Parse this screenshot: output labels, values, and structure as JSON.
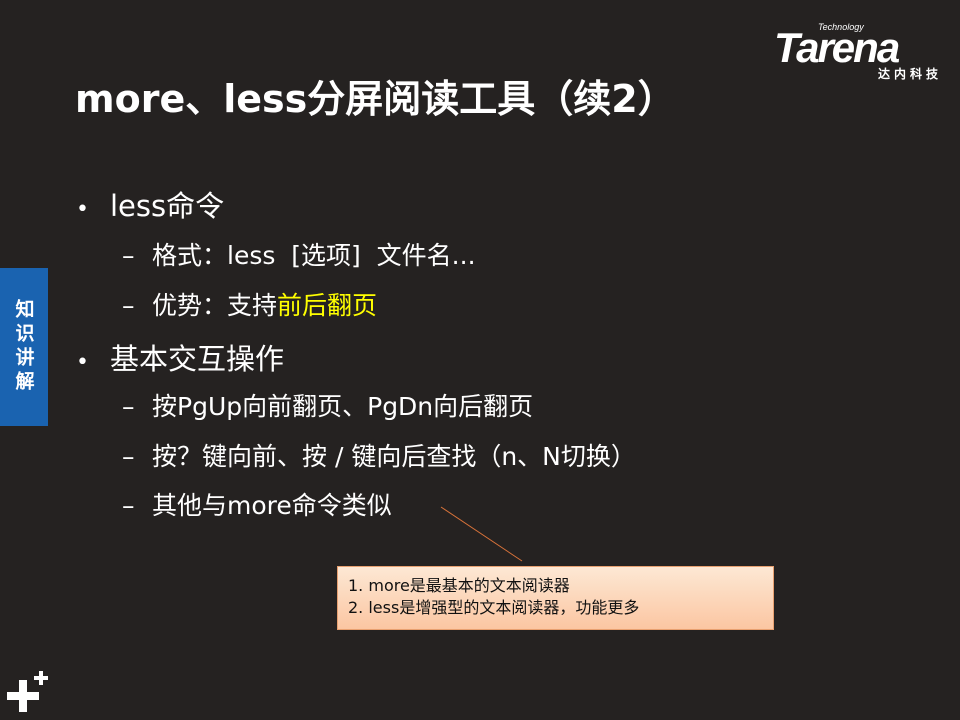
{
  "logo": {
    "small": "Technology",
    "main": "Tarena",
    "sub": "达内科技"
  },
  "title": "more、less分屏阅读工具（续2）",
  "side_tab": "知识讲解",
  "bullets": [
    {
      "text": "less命令",
      "level": 1
    },
    {
      "text": "格式：less  [选项]  文件名...",
      "level": 2
    },
    {
      "text_before": "优势：支持",
      "text_highlight": "前后翻页",
      "level": 2
    },
    {
      "text": "基本交互操作",
      "level": 1
    },
    {
      "text": "按PgUp向前翻页、PgDn向后翻页",
      "level": 2
    },
    {
      "text": "按？键向前、按 / 键向后查找（n、N切换）",
      "level": 2
    },
    {
      "text": "其他与more命令类似",
      "level": 2
    }
  ],
  "note": {
    "line1": "1. more是最基本的文本阅读器",
    "line2": "2. less是增强型的文本阅读器，功能更多"
  },
  "colors": {
    "background": "#252221",
    "highlight": "#ffff00",
    "side_tab": "#1a63b0",
    "note_bg": "#fbd4b4"
  },
  "icons": {
    "bullet": "•",
    "dash": "–",
    "corner": "plus-icon"
  }
}
